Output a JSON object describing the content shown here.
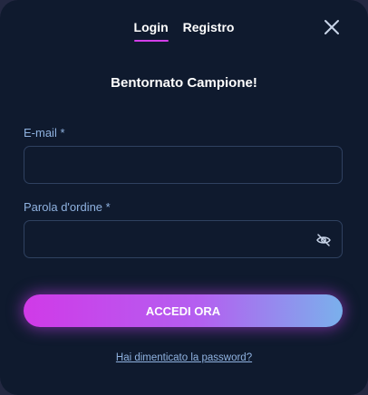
{
  "tabs": [
    {
      "label": "Login",
      "active": true
    },
    {
      "label": "Registro",
      "active": false
    }
  ],
  "close_icon": "close-icon",
  "title": "Bentornato Campione!",
  "form": {
    "email": {
      "label": "E-mail *",
      "value": "",
      "placeholder": ""
    },
    "password": {
      "label": "Parola d'ordine *",
      "value": "",
      "placeholder": "",
      "toggle_icon": "eye-off-icon"
    }
  },
  "submit_label": "ACCEDI ORA",
  "forgot_link": "Hai dimenticato la password?",
  "colors": {
    "background": "#0f1a2e",
    "accent_start": "#d03ae8",
    "accent_end": "#7ab0ec",
    "label": "#8fb2e0",
    "input_border": "#2f4160"
  }
}
